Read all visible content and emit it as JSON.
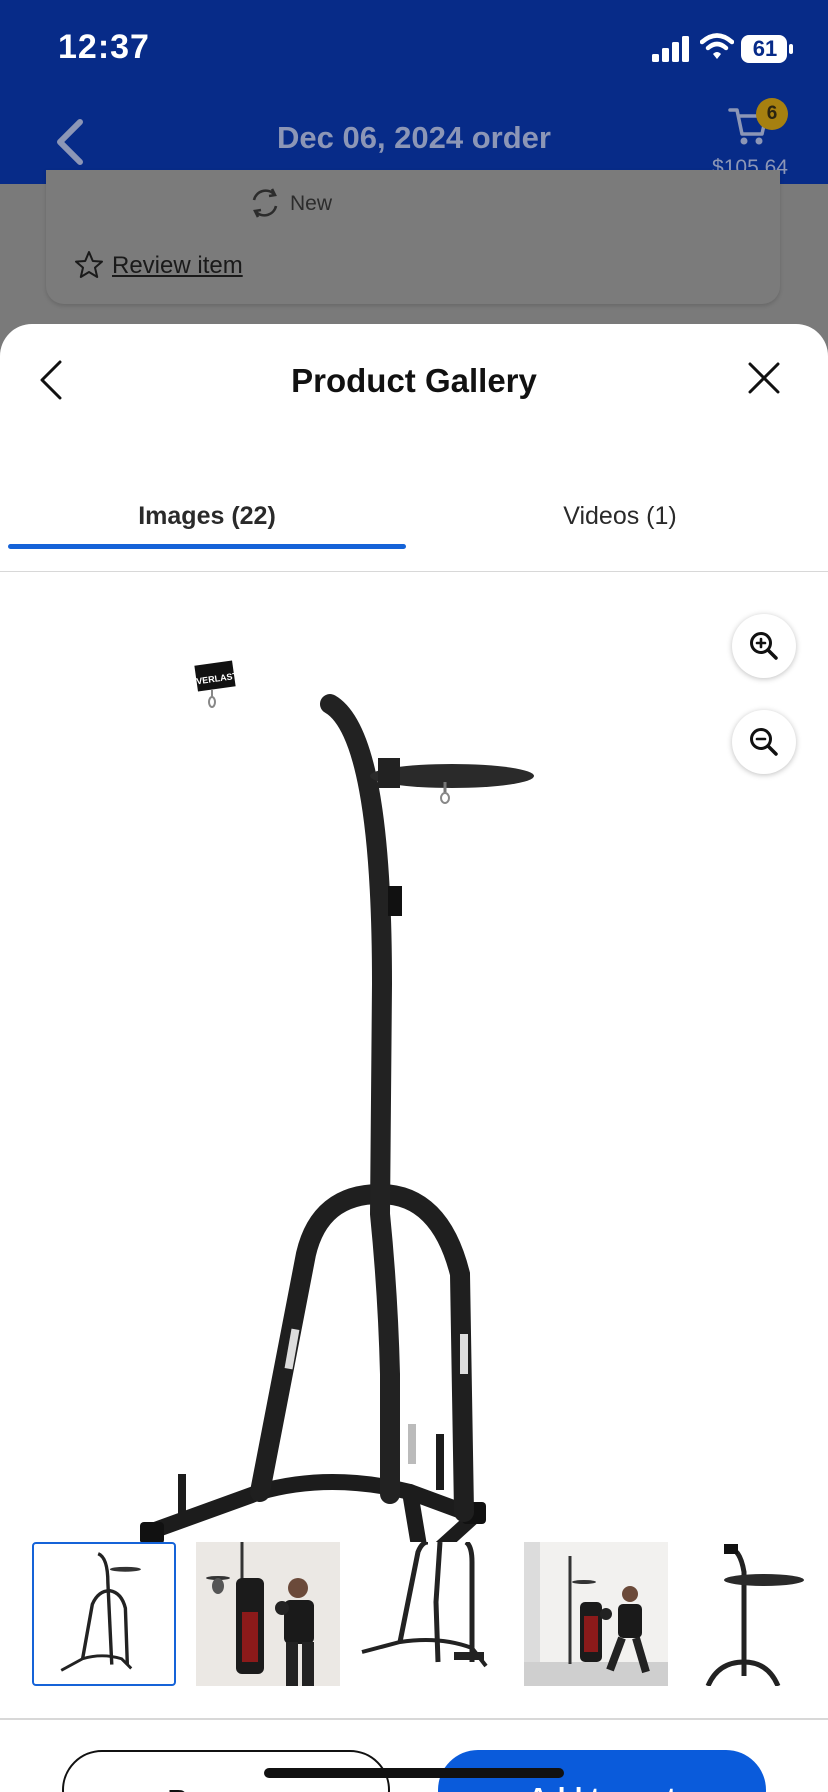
{
  "status_bar": {
    "time": "12:37",
    "battery": "61"
  },
  "header": {
    "title": "Dec 06, 2024 order",
    "cart_count": "6",
    "cart_total": "$105.64"
  },
  "background_card": {
    "condition": "New",
    "review_link": "Review item"
  },
  "gallery": {
    "title": "Product Gallery",
    "tabs": [
      {
        "label": "Images (22)",
        "selected": true
      },
      {
        "label": "Videos (1)",
        "selected": false
      }
    ],
    "zoom_in_icon": "zoom-in-icon",
    "zoom_out_icon": "zoom-out-icon",
    "main_image": {
      "brand_text": "EVERLAST"
    },
    "thumbnails": [
      {
        "name": "stand-front",
        "selected": true
      },
      {
        "name": "boxer-heavy-bag",
        "selected": false
      },
      {
        "name": "stand-closeup",
        "selected": false
      },
      {
        "name": "boxer-punching",
        "selected": false
      },
      {
        "name": "stand-top",
        "selected": false
      }
    ]
  },
  "actions": {
    "buy_now": "Buy now",
    "add_to_cart": "Add to cart"
  },
  "colors": {
    "header_blue": "#072b88",
    "accent_blue": "#1563d8",
    "cta_blue": "#0a5bdb",
    "badge_yellow": "#a68010"
  }
}
